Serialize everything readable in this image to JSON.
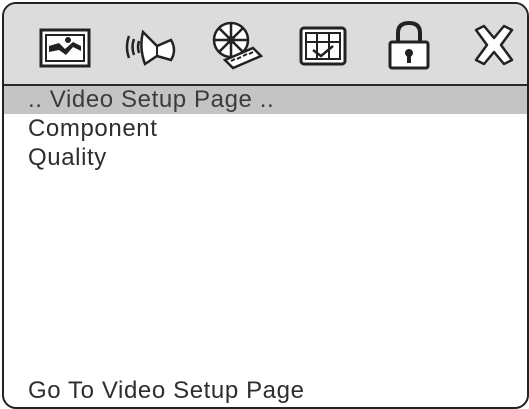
{
  "toolbar": {
    "icons": [
      {
        "name": "general-setup-icon"
      },
      {
        "name": "audio-setup-icon"
      },
      {
        "name": "video-setup-icon"
      },
      {
        "name": "preference-page-icon"
      },
      {
        "name": "password-lock-icon"
      },
      {
        "name": "exit-icon"
      }
    ]
  },
  "page": {
    "header": ".. Video Setup Page ..",
    "items": [
      {
        "label": "Component"
      },
      {
        "label": "Quality"
      }
    ],
    "footer": "Go To Video Setup Page"
  },
  "colors": {
    "toolbar_bg": "#dcdcdc",
    "header_highlight": "#c4c4c4",
    "text": "#2e2e2e",
    "border": "#222222"
  }
}
